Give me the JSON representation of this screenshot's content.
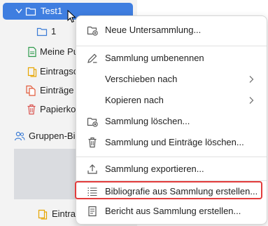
{
  "tree": {
    "items": [
      {
        "label": "Test1"
      },
      {
        "label": "1"
      },
      {
        "label": "Meine Pu"
      },
      {
        "label": "Eintragsc"
      },
      {
        "label": "Einträge"
      },
      {
        "label": "Papierko"
      },
      {
        "label": "Gruppen-Bil"
      },
      {
        "label": "Eintrag"
      }
    ]
  },
  "menu": {
    "items": [
      {
        "label": "Neue Untersammlung..."
      },
      {
        "label": "Sammlung umbenennen"
      },
      {
        "label": "Verschieben nach"
      },
      {
        "label": "Kopieren nach"
      },
      {
        "label": "Sammlung löschen..."
      },
      {
        "label": "Sammlung und Einträge löschen..."
      },
      {
        "label": "Sammlung exportieren..."
      },
      {
        "label": "Bibliografie aus Sammlung erstellen..."
      },
      {
        "label": "Bericht aus Sammlung erstellen..."
      }
    ]
  },
  "colors": {
    "selection": "#3f7ee0",
    "highlight_border": "#e23c3c",
    "menu_icon": "#555555",
    "folder_blue": "#3a7bd5",
    "doc_green": "#2e9a4b",
    "unfiled_orange": "#e6a500",
    "duplicate_red": "#e25a3a",
    "trash_red": "#d9534f"
  }
}
